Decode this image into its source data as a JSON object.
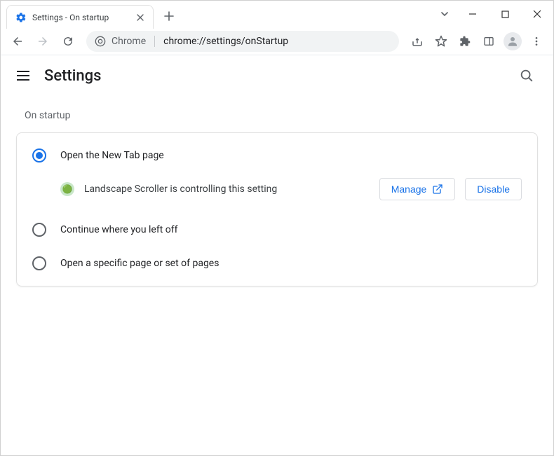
{
  "tab": {
    "title": "Settings - On startup"
  },
  "omnibox": {
    "host": "Chrome",
    "path": "chrome://settings/onStartup"
  },
  "settings": {
    "title": "Settings"
  },
  "section": {
    "title": "On startup"
  },
  "options": {
    "opt1": "Open the New Tab page",
    "opt2": "Continue where you left off",
    "opt3": "Open a specific page or set of pages"
  },
  "extension": {
    "message": "Landscape Scroller is controlling this setting",
    "manage": "Manage",
    "disable": "Disable"
  }
}
